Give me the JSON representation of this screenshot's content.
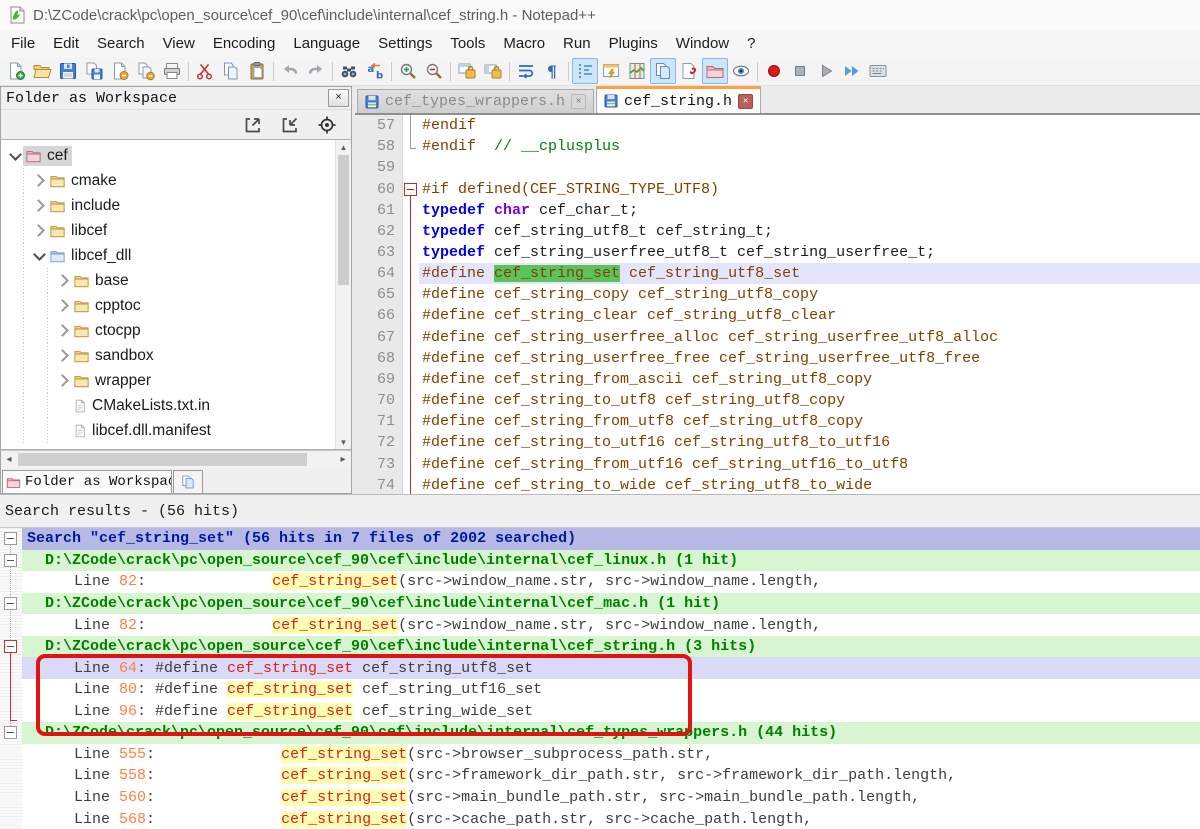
{
  "window_title": "D:\\ZCode\\crack\\pc\\open_source\\cef_90\\cef\\include\\internal\\cef_string.h - Notepad++",
  "menu": {
    "items": [
      "File",
      "Edit",
      "Search",
      "View",
      "Encoding",
      "Language",
      "Settings",
      "Tools",
      "Macro",
      "Run",
      "Plugins",
      "Window",
      "?"
    ]
  },
  "toolbar": {
    "icons": [
      {
        "name": "new-file"
      },
      {
        "name": "open-file"
      },
      {
        "name": "save-file"
      },
      {
        "name": "save-copy"
      },
      {
        "name": "close-file"
      },
      {
        "name": "close-all"
      },
      {
        "name": "print"
      },
      {
        "name": "separator"
      },
      {
        "name": "cut"
      },
      {
        "name": "copy"
      },
      {
        "name": "paste"
      },
      {
        "name": "separator"
      },
      {
        "name": "undo"
      },
      {
        "name": "redo"
      },
      {
        "name": "separator"
      },
      {
        "name": "find"
      },
      {
        "name": "replace"
      },
      {
        "name": "separator"
      },
      {
        "name": "zoom-in"
      },
      {
        "name": "zoom-out"
      },
      {
        "name": "separator"
      },
      {
        "name": "sync-vertical"
      },
      {
        "name": "sync-horizontal"
      },
      {
        "name": "separator"
      },
      {
        "name": "word-wrap"
      },
      {
        "name": "show-all-characters"
      },
      {
        "name": "separator"
      },
      {
        "name": "indent-guide",
        "pressed": true
      },
      {
        "name": "function-list"
      },
      {
        "name": "document-map"
      },
      {
        "name": "document-switcher",
        "pressed": true
      },
      {
        "name": "run-script"
      },
      {
        "name": "folder-as-workspace",
        "pressed": true
      },
      {
        "name": "preview"
      },
      {
        "name": "separator"
      },
      {
        "name": "macro-record"
      },
      {
        "name": "macro-stop"
      },
      {
        "name": "macro-play"
      },
      {
        "name": "macro-run-multiple"
      },
      {
        "name": "macro-save"
      }
    ]
  },
  "sidebar": {
    "title": "Folder as Workspace",
    "tools": [
      "expand-all",
      "collapse-all",
      "locate-file"
    ],
    "bottom_tab_label": "Folder as Workspac",
    "tree": [
      {
        "label": "cef",
        "depth": 0,
        "type": "folder-root",
        "expanded": true,
        "selected": true
      },
      {
        "label": "cmake",
        "depth": 1,
        "type": "folder"
      },
      {
        "label": "include",
        "depth": 1,
        "type": "folder"
      },
      {
        "label": "libcef",
        "depth": 1,
        "type": "folder"
      },
      {
        "label": "libcef_dll",
        "depth": 1,
        "type": "folder-open",
        "expanded": true
      },
      {
        "label": "base",
        "depth": 2,
        "type": "folder"
      },
      {
        "label": "cpptoc",
        "depth": 2,
        "type": "folder"
      },
      {
        "label": "ctocpp",
        "depth": 2,
        "type": "folder"
      },
      {
        "label": "sandbox",
        "depth": 2,
        "type": "folder"
      },
      {
        "label": "wrapper",
        "depth": 2,
        "type": "folder"
      },
      {
        "label": "CMakeLists.txt.in",
        "depth": 2,
        "type": "file"
      },
      {
        "label": "libcef.dll.manifest",
        "depth": 2,
        "type": "file"
      }
    ]
  },
  "editor": {
    "tabs": [
      {
        "label": "cef_types_wrappers.h",
        "active": false
      },
      {
        "label": "cef_string.h",
        "active": true
      }
    ],
    "lines": [
      {
        "num": "57",
        "margin": "g1",
        "segments": [
          {
            "t": "#endif",
            "c": "pre"
          }
        ]
      },
      {
        "num": "58",
        "margin": "g2",
        "segments": [
          {
            "t": "#endif  ",
            "c": "pre"
          },
          {
            "t": "// __cplusplus",
            "c": "com"
          }
        ]
      },
      {
        "num": "59",
        "margin": "",
        "segments": []
      },
      {
        "num": "60",
        "margin": "rb",
        "segments": [
          {
            "t": "#if defined(CEF_STRING_TYPE_UTF8)",
            "c": "pre"
          }
        ]
      },
      {
        "num": "61",
        "margin": "rl",
        "segments": [
          {
            "t": "typedef",
            "c": "kw"
          },
          {
            "t": " ",
            "c": "pln"
          },
          {
            "t": "char",
            "c": "typ"
          },
          {
            "t": " cef_char_t;",
            "c": "pln"
          }
        ]
      },
      {
        "num": "62",
        "margin": "rl",
        "segments": [
          {
            "t": "typedef",
            "c": "kw"
          },
          {
            "t": " cef_string_utf8_t cef_string_t;",
            "c": "pln"
          }
        ]
      },
      {
        "num": "63",
        "margin": "rl",
        "segments": [
          {
            "t": "typedef",
            "c": "kw"
          },
          {
            "t": " cef_string_userfree_utf8_t cef_string_userfree_t;",
            "c": "pln"
          }
        ]
      },
      {
        "num": "64",
        "margin": "rl",
        "current": true,
        "segments": [
          {
            "t": "#define ",
            "c": "pre"
          },
          {
            "t": "cef_string_set",
            "c": "pre hl"
          },
          {
            "t": " cef_string_utf8_set",
            "c": "pre"
          }
        ]
      },
      {
        "num": "65",
        "margin": "rl",
        "segments": [
          {
            "t": "#define cef_string_copy cef_string_utf8_copy",
            "c": "pre"
          }
        ]
      },
      {
        "num": "66",
        "margin": "rl",
        "segments": [
          {
            "t": "#define cef_string_clear cef_string_utf8_clear",
            "c": "pre"
          }
        ]
      },
      {
        "num": "67",
        "margin": "rl",
        "segments": [
          {
            "t": "#define cef_string_userfree_alloc cef_string_userfree_utf8_alloc",
            "c": "pre"
          }
        ]
      },
      {
        "num": "68",
        "margin": "rl",
        "segments": [
          {
            "t": "#define cef_string_userfree_free cef_string_userfree_utf8_free",
            "c": "pre"
          }
        ]
      },
      {
        "num": "69",
        "margin": "rl",
        "segments": [
          {
            "t": "#define cef_string_from_ascii cef_string_utf8_copy",
            "c": "pre"
          }
        ]
      },
      {
        "num": "70",
        "margin": "rl",
        "segments": [
          {
            "t": "#define cef_string_to_utf8 cef_string_utf8_copy",
            "c": "pre"
          }
        ]
      },
      {
        "num": "71",
        "margin": "rl",
        "segments": [
          {
            "t": "#define cef_string_from_utf8 cef_string_utf8_copy",
            "c": "pre"
          }
        ]
      },
      {
        "num": "72",
        "margin": "rl",
        "segments": [
          {
            "t": "#define cef_string_to_utf16 cef_string_utf8_to_utf16",
            "c": "pre"
          }
        ]
      },
      {
        "num": "73",
        "margin": "rl",
        "segments": [
          {
            "t": "#define cef_string_from_utf16 cef_string_utf16_to_utf8",
            "c": "pre"
          }
        ]
      },
      {
        "num": "74",
        "margin": "rl",
        "segments": [
          {
            "t": "#define cef_string_to_wide cef_string_utf8_to_wide",
            "c": "pre"
          }
        ]
      }
    ]
  },
  "search_panel": {
    "title": "Search results - (56 hits)",
    "rows": [
      {
        "type": "search",
        "text": "Search \"cef_string_set\" (56 hits in 7 files of 2002 searched)"
      },
      {
        "type": "file",
        "text": "D:\\ZCode\\crack\\pc\\open_source\\cef_90\\cef\\include\\internal\\cef_linux.h (1 hit)"
      },
      {
        "type": "hit",
        "line": "82",
        "gap": "              ",
        "pre": "",
        "match": "cef_string_set",
        "post": "(src->window_name.str, src->window_name.length,"
      },
      {
        "type": "file",
        "text": "D:\\ZCode\\crack\\pc\\open_source\\cef_90\\cef\\include\\internal\\cef_mac.h (1 hit)"
      },
      {
        "type": "hit",
        "line": "82",
        "gap": "              ",
        "pre": "",
        "match": "cef_string_set",
        "post": "(src->window_name.str, src->window_name.length,"
      },
      {
        "type": "file",
        "text": "D:\\ZCode\\crack\\pc\\open_source\\cef_90\\cef\\include\\internal\\cef_string.h (3 hits)",
        "red_fold": true
      },
      {
        "type": "hit",
        "line": "64",
        "gap": " ",
        "pre": "#define ",
        "match": "cef_string_set",
        "post": " cef_string_utf8_set",
        "selected": true
      },
      {
        "type": "hit",
        "line": "80",
        "gap": " ",
        "pre": "#define ",
        "match": "cef_string_set",
        "post": " cef_string_utf16_set"
      },
      {
        "type": "hit",
        "line": "96",
        "gap": " ",
        "pre": "#define ",
        "match": "cef_string_set",
        "post": " cef_string_wide_set"
      },
      {
        "type": "file",
        "text": "D:\\ZCode\\crack\\pc\\open_source\\cef_90\\cef\\include\\internal\\cef_types_wrappers.h (44 hits)"
      },
      {
        "type": "hit",
        "line": "555",
        "gap": "              ",
        "pre": "",
        "match": "cef_string_set",
        "post": "(src->browser_subprocess_path.str,"
      },
      {
        "type": "hit",
        "line": "558",
        "gap": "              ",
        "pre": "",
        "match": "cef_string_set",
        "post": "(src->framework_dir_path.str, src->framework_dir_path.length,"
      },
      {
        "type": "hit",
        "line": "560",
        "gap": "              ",
        "pre": "",
        "match": "cef_string_set",
        "post": "(src->main_bundle_path.str, src->main_bundle_path.length,"
      },
      {
        "type": "hit",
        "line": "568",
        "gap": "              ",
        "pre": "",
        "match": "cef_string_set",
        "post": "(src->cache_path.str, src->cache_path.length,"
      }
    ],
    "annotation": {
      "highlighted_lines": [
        "64",
        "80",
        "96"
      ],
      "color": "#e21212"
    }
  }
}
